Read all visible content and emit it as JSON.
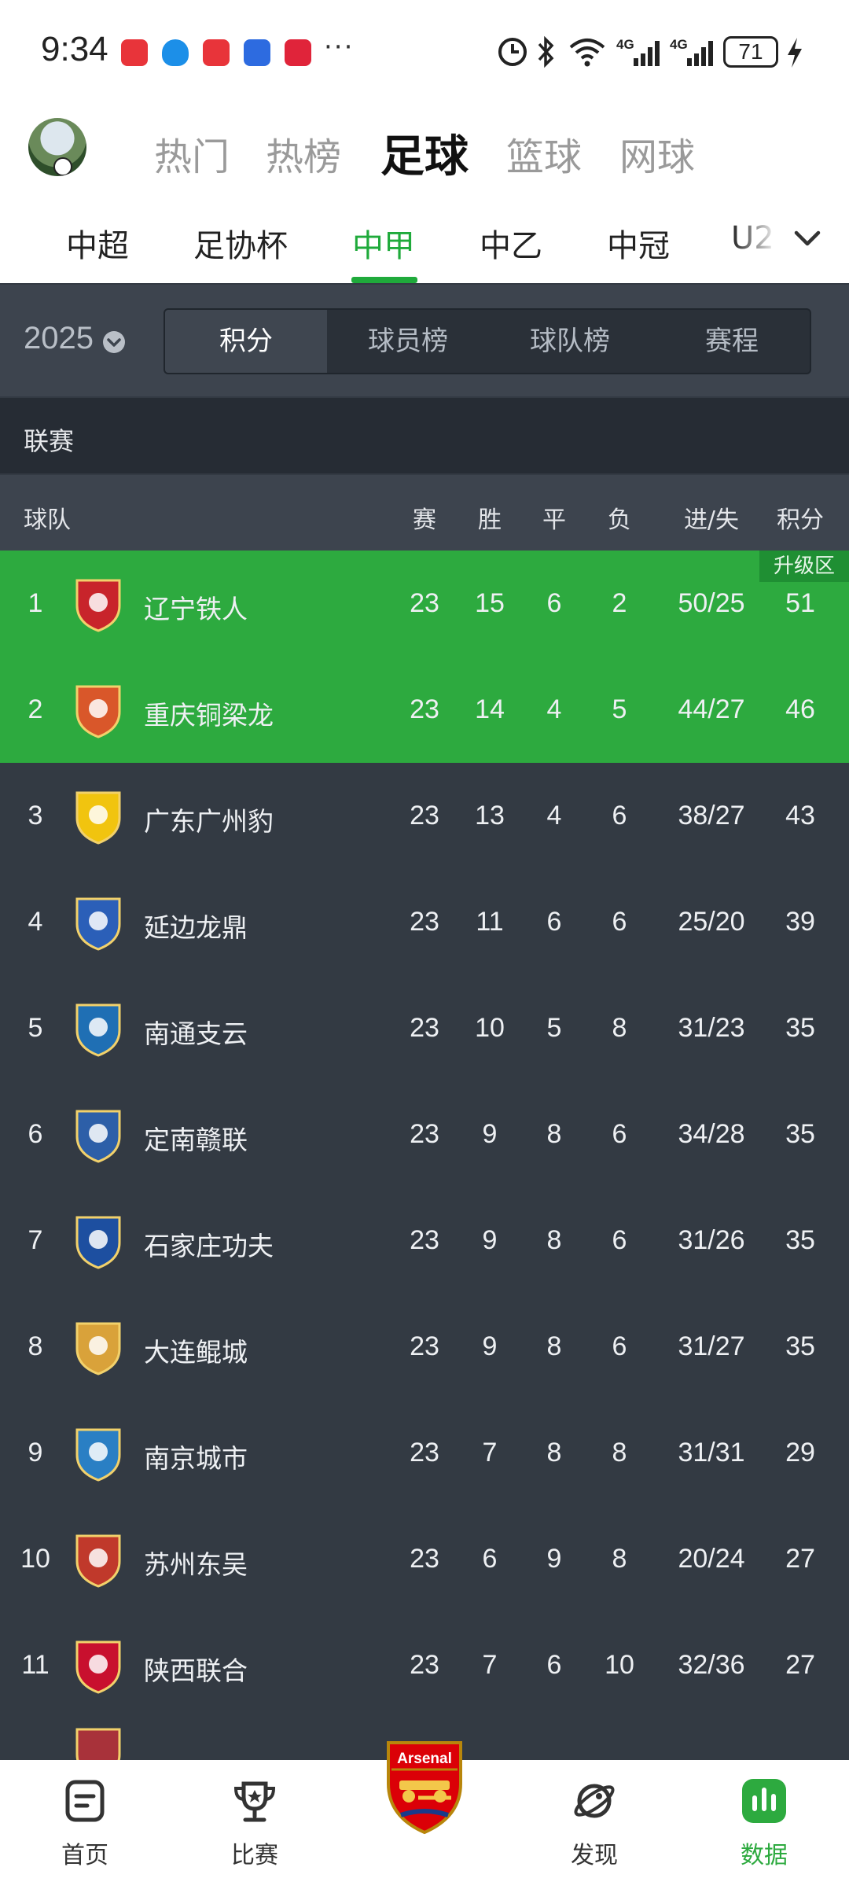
{
  "status_bar": {
    "time": "9:34",
    "battery": "71",
    "notification_icons": [
      "huawei-store-icon",
      "shield-icon",
      "huawei-app-icon",
      "hand-app-icon",
      "heart-app-icon"
    ],
    "system_icons": [
      "silent-clock-icon",
      "bluetooth-icon",
      "wifi-icon",
      "signal-4g-icon",
      "signal-4g-icon",
      "battery-icon",
      "charging-icon"
    ]
  },
  "header": {
    "main_tabs": [
      {
        "label": "热门",
        "active": false
      },
      {
        "label": "热榜",
        "active": false
      },
      {
        "label": "足球",
        "active": true
      },
      {
        "label": "篮球",
        "active": false
      },
      {
        "label": "网球",
        "active": false
      }
    ],
    "sub_tabs": [
      {
        "label": "中超",
        "active": false
      },
      {
        "label": "足协杯",
        "active": false
      },
      {
        "label": "中甲",
        "active": true
      },
      {
        "label": "中乙",
        "active": false
      },
      {
        "label": "中冠",
        "active": false
      },
      {
        "label": "U2",
        "active": false
      }
    ]
  },
  "filter": {
    "season": "2025",
    "segments": [
      {
        "label": "积分",
        "active": true
      },
      {
        "label": "球员榜",
        "active": false
      },
      {
        "label": "球队榜",
        "active": false
      },
      {
        "label": "赛程",
        "active": false
      }
    ]
  },
  "section_label": "联赛",
  "table": {
    "headers": {
      "team": "球队",
      "played": "赛",
      "won": "胜",
      "drawn": "平",
      "lost": "负",
      "goals": "进/失",
      "points": "积分"
    },
    "zone_label": "升级区",
    "rows": [
      {
        "rank": "1",
        "team": "辽宁铁人",
        "played": "23",
        "won": "15",
        "drawn": "6",
        "lost": "2",
        "goals": "50/25",
        "points": "51",
        "promo": true,
        "logo_color": "#c8242b"
      },
      {
        "rank": "2",
        "team": "重庆铜梁龙",
        "played": "23",
        "won": "14",
        "drawn": "4",
        "lost": "5",
        "goals": "44/27",
        "points": "46",
        "promo": true,
        "logo_color": "#d9572a"
      },
      {
        "rank": "3",
        "team": "广东广州豹",
        "played": "23",
        "won": "13",
        "drawn": "4",
        "lost": "6",
        "goals": "38/27",
        "points": "43",
        "promo": false,
        "logo_color": "#f1c40f"
      },
      {
        "rank": "4",
        "team": "延边龙鼎",
        "played": "23",
        "won": "11",
        "drawn": "6",
        "lost": "6",
        "goals": "25/20",
        "points": "39",
        "promo": false,
        "logo_color": "#2b5fb8"
      },
      {
        "rank": "5",
        "team": "南通支云",
        "played": "23",
        "won": "10",
        "drawn": "5",
        "lost": "8",
        "goals": "31/23",
        "points": "35",
        "promo": false,
        "logo_color": "#1f6fb4"
      },
      {
        "rank": "6",
        "team": "定南赣联",
        "played": "23",
        "won": "9",
        "drawn": "8",
        "lost": "6",
        "goals": "34/28",
        "points": "35",
        "promo": false,
        "logo_color": "#2d5fa8"
      },
      {
        "rank": "7",
        "team": "石家庄功夫",
        "played": "23",
        "won": "9",
        "drawn": "8",
        "lost": "6",
        "goals": "31/26",
        "points": "35",
        "promo": false,
        "logo_color": "#1d4fa0"
      },
      {
        "rank": "8",
        "team": "大连鲲城",
        "played": "23",
        "won": "9",
        "drawn": "8",
        "lost": "6",
        "goals": "31/27",
        "points": "35",
        "promo": false,
        "logo_color": "#d9a23a"
      },
      {
        "rank": "9",
        "team": "南京城市",
        "played": "23",
        "won": "7",
        "drawn": "8",
        "lost": "8",
        "goals": "31/31",
        "points": "29",
        "promo": false,
        "logo_color": "#2a7fc4"
      },
      {
        "rank": "10",
        "team": "苏州东吴",
        "played": "23",
        "won": "6",
        "drawn": "9",
        "lost": "8",
        "goals": "20/24",
        "points": "27",
        "promo": false,
        "logo_color": "#c0392b"
      },
      {
        "rank": "11",
        "team": "陕西联合",
        "played": "23",
        "won": "7",
        "drawn": "6",
        "lost": "10",
        "goals": "32/36",
        "points": "27",
        "promo": false,
        "logo_color": "#c8102e"
      }
    ]
  },
  "bottom_nav": [
    {
      "label": "首页",
      "icon": "home-doc-icon",
      "active": false
    },
    {
      "label": "比赛",
      "icon": "trophy-icon",
      "active": false
    },
    {
      "label": "",
      "icon": "arsenal-crest-icon",
      "active": false
    },
    {
      "label": "发现",
      "icon": "planet-icon",
      "active": false
    },
    {
      "label": "数据",
      "icon": "bar-chart-icon",
      "active": true
    }
  ],
  "center_badge_text": "Arsenal"
}
